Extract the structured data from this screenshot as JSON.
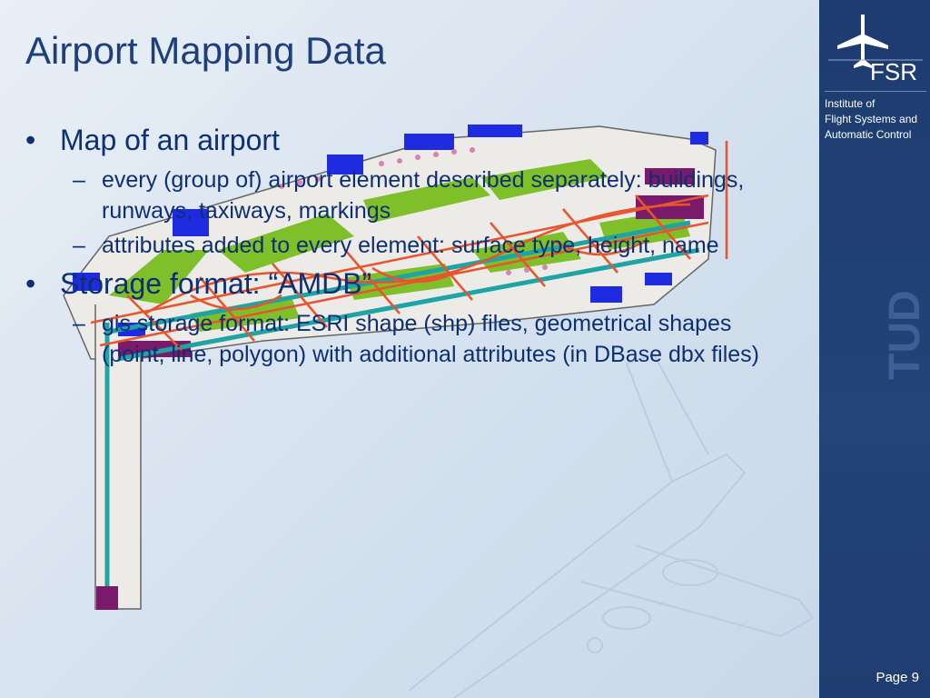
{
  "slide": {
    "title": "Airport Mapping Data",
    "bullets": [
      {
        "text": "Map of an airport",
        "subitems": [
          "every (group of) airport element described separately: buildings, runways, taxiways, markings",
          "attributes added to every element: surface type, height, name"
        ]
      },
      {
        "text": "Storage format: “AMDB”",
        "subitems": [
          "gis storage format: ESRI shape (shp) files, geometrical shapes (point, line, polygon) with additional attributes (in DBase dbx files)"
        ]
      }
    ]
  },
  "sidebar": {
    "logo_text": "FSR",
    "institute_lines": [
      "Institute of",
      "Flight Systems and",
      "Automatic Control"
    ],
    "vertical_logo_text": "TUD"
  },
  "page": {
    "label": "Page 9"
  },
  "colors": {
    "title": "#1f3f7c",
    "body_text": "#0d2f73",
    "sidebar": "#1d3b6f"
  },
  "icons": [
    "airplane-icon",
    "airplane-watermark"
  ]
}
